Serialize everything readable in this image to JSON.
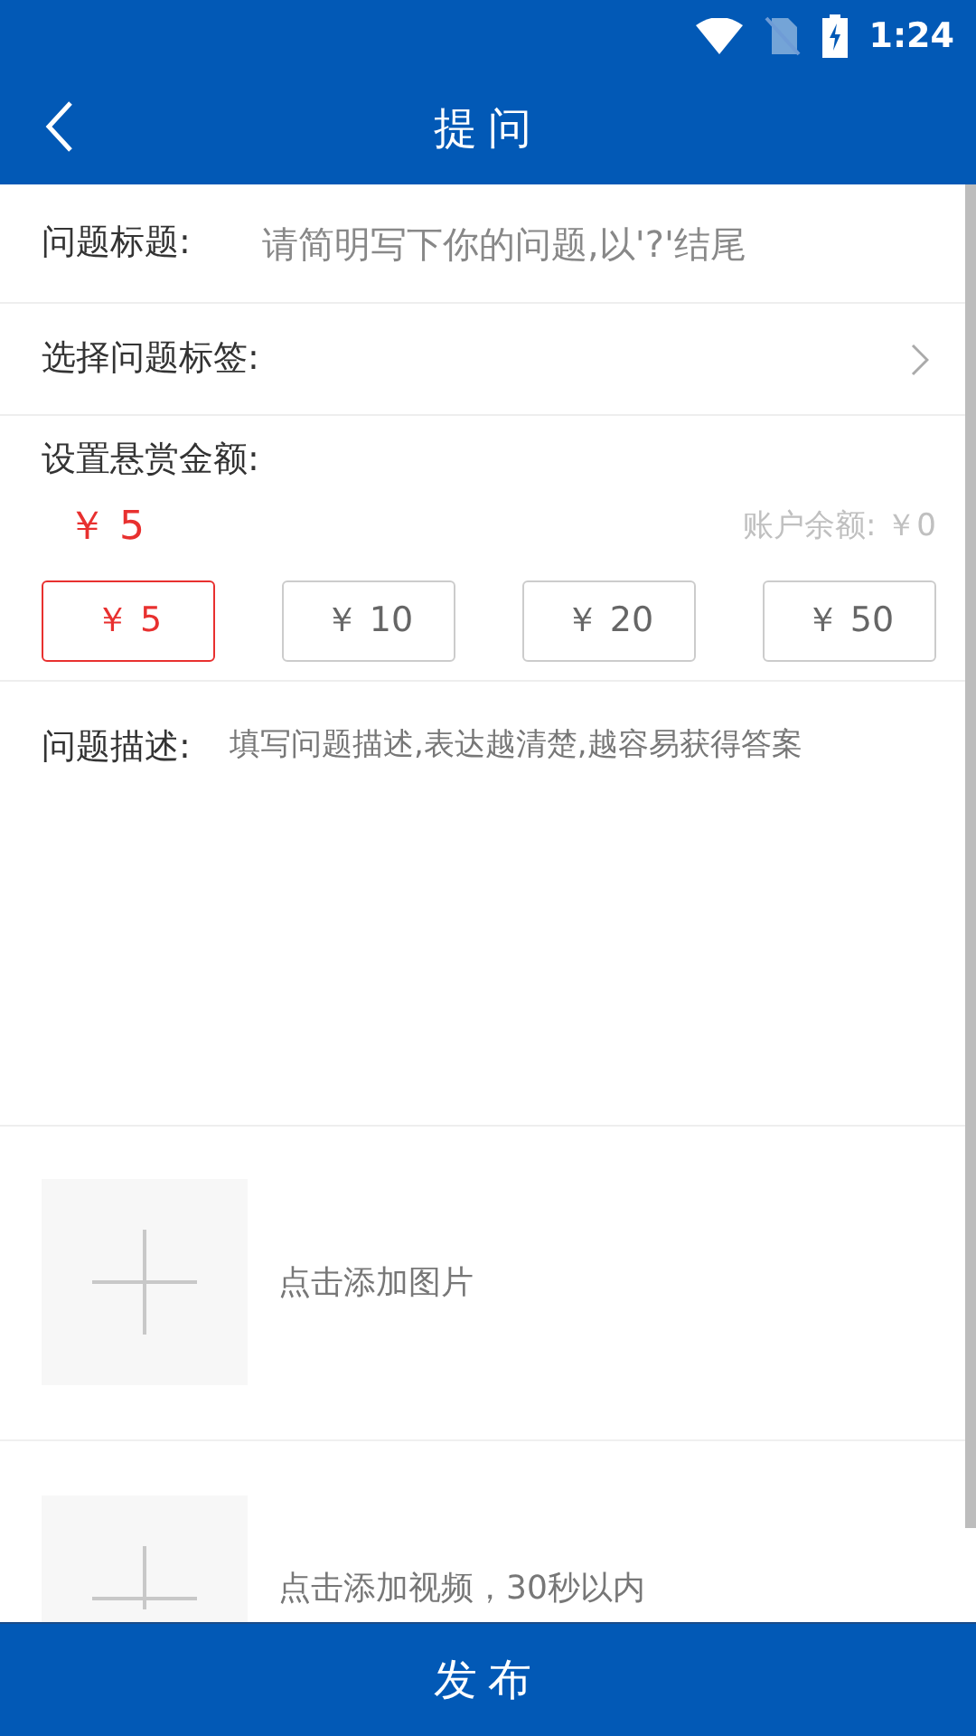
{
  "status_bar": {
    "time": "1:24"
  },
  "header": {
    "title": "提问"
  },
  "question_title": {
    "label": "问题标题:",
    "placeholder": "请简明写下你的问题,以'?'结尾"
  },
  "tag_row": {
    "label": "选择问题标签:"
  },
  "reward": {
    "label": "设置悬赏金额:",
    "amount": "￥ 5",
    "balance": "账户余额: ￥0",
    "options": [
      {
        "label": "￥ 5",
        "selected": true
      },
      {
        "label": "￥ 10",
        "selected": false
      },
      {
        "label": "￥ 20",
        "selected": false
      },
      {
        "label": "￥ 50",
        "selected": false
      }
    ]
  },
  "description": {
    "label": "问题描述:",
    "placeholder": "填写问题描述,表达越清楚,越容易获得答案"
  },
  "uploads": [
    {
      "label": "点击添加图片"
    },
    {
      "label": "点击添加视频，30秒以内"
    }
  ],
  "submit_button": "发布"
}
